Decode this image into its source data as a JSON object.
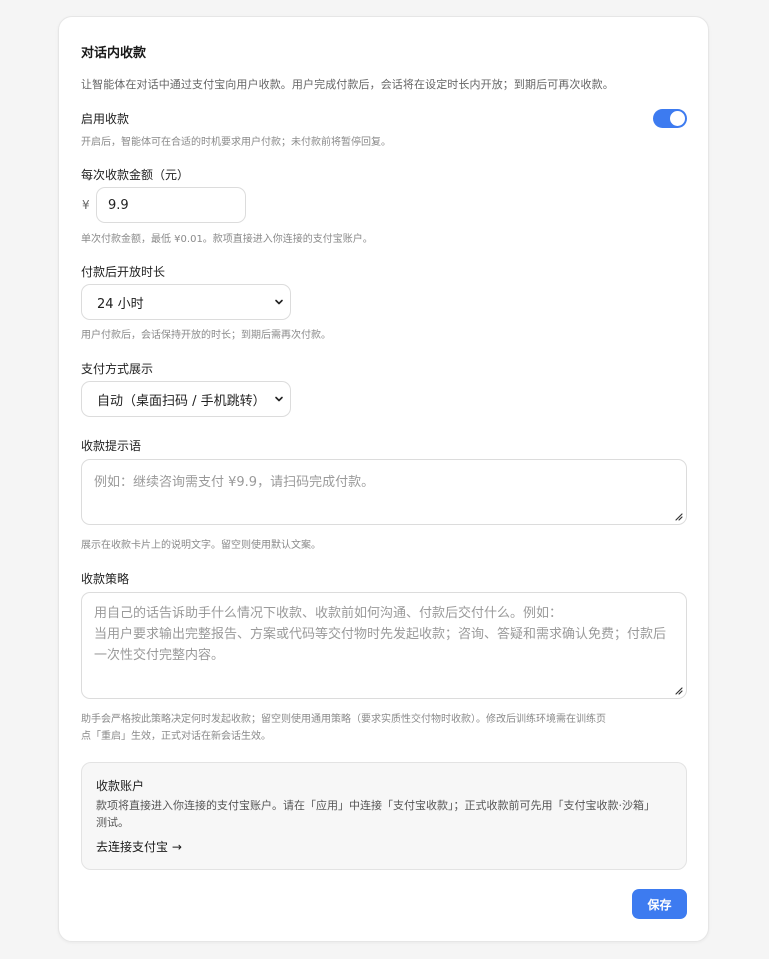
{
  "title": "对话内收款",
  "intro": "让智能体在对话中通过支付宝向用户收款。用户完成付款后，会话将在设定时长内开放；到期后可再次收款。",
  "enable": {
    "label": "启用收款",
    "hint": "开启后，智能体可在合适的时机要求用户付款；未付款前将暂停回复。",
    "on": true
  },
  "amount": {
    "label": "每次收款金额（元）",
    "currency": "¥",
    "value": "9.9",
    "hint": "单次付款金额，最低 ¥0.01。款项直接进入你连接的支付宝账户。"
  },
  "duration": {
    "label": "付款后开放时长",
    "selected": "24 小时",
    "hint": "用户付款后，会话保持开放的时长；到期后需再次付款。"
  },
  "payment_display": {
    "label": "支付方式展示",
    "selected": "自动（桌面扫码 / 手机跳转）"
  },
  "prompt": {
    "label": "收款提示语",
    "placeholder": "例如：继续咨询需支付 ¥9.9，请扫码完成付款。",
    "hint": "展示在收款卡片上的说明文字。留空则使用默认文案。"
  },
  "strategy": {
    "label": "收款策略",
    "placeholder_lines": [
      "用自己的话告诉助手什么情况下收款、收款前如何沟通、付款后交付什么。例如：",
      "当用户要求输出完整报告、方案或代码等交付物时先发起收款；咨询、答疑和需求确认免费；付款后",
      "一次性交付完整内容。"
    ],
    "hint_lines": [
      "助手会严格按此策略决定何时发起收款；留空则使用通用策略（要求实质性交付物时收款）。修改后训练环境需在训练页",
      "点「重启」生效，正式对话在新会话生效。"
    ]
  },
  "account": {
    "title": "收款账户",
    "desc_lines": [
      "款项将直接进入你连接的支付宝账户。请在「应用」中连接「支付宝收款」；正式收款前可先用「支付宝收款·沙箱」",
      "测试。"
    ],
    "link": "去连接支付宝 →"
  },
  "save_label": "保存",
  "colors": {
    "accent": "#3d7bf0"
  }
}
